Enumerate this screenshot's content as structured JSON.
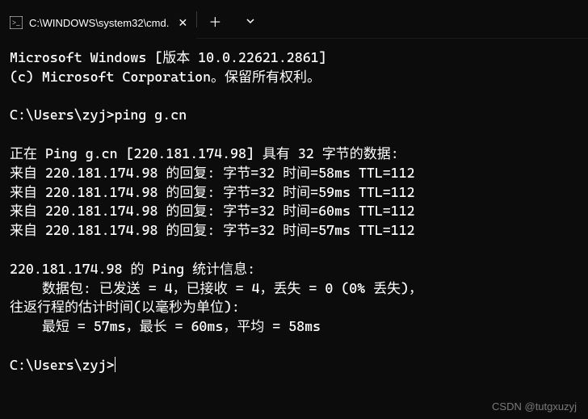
{
  "titlebar": {
    "tab_title": "C:\\WINDOWS\\system32\\cmd.",
    "close_glyph": "✕",
    "new_tab_glyph": "＋",
    "dropdown_glyph": "⌄"
  },
  "terminal": {
    "line_version": "Microsoft Windows [版本 10.0.22621.2861]",
    "line_copyright": "(c) Microsoft Corporation。保留所有权利。",
    "prompt1": "C:\\Users\\zyj>",
    "command1": "ping g.cn",
    "ping_header": "正在 Ping g.cn [220.181.174.98] 具有 32 字节的数据:",
    "reply1": "来自 220.181.174.98 的回复: 字节=32 时间=58ms TTL=112",
    "reply2": "来自 220.181.174.98 的回复: 字节=32 时间=59ms TTL=112",
    "reply3": "来自 220.181.174.98 的回复: 字节=32 时间=60ms TTL=112",
    "reply4": "来自 220.181.174.98 的回复: 字节=32 时间=57ms TTL=112",
    "stats_header": "220.181.174.98 的 Ping 统计信息:",
    "packets": "    数据包: 已发送 = 4，已接收 = 4，丢失 = 0 (0% 丢失)，",
    "rtt_header": "往返行程的估计时间(以毫秒为单位):",
    "rtt_values": "    最短 = 57ms，最长 = 60ms，平均 = 58ms",
    "prompt2": "C:\\Users\\zyj>"
  },
  "watermark": "CSDN @tutgxuzyj"
}
